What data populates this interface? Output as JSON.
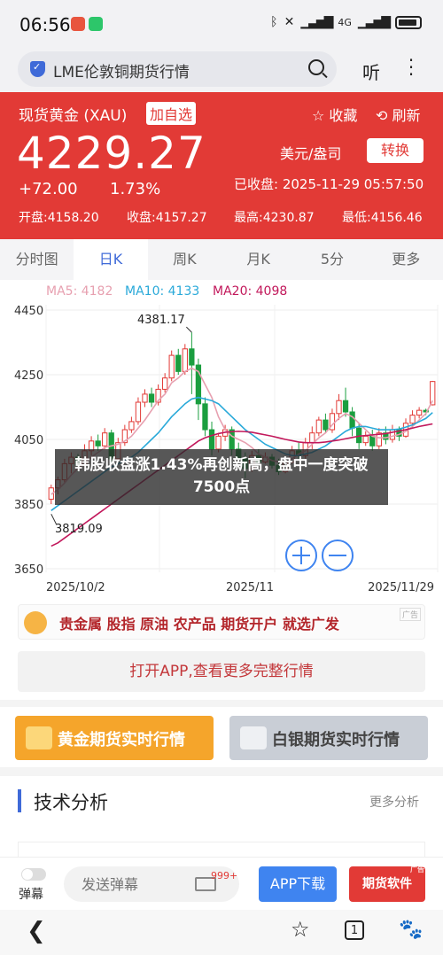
{
  "status_bar": {
    "time": "06:56",
    "network": "4G",
    "icons": [
      "weibo-icon",
      "wechat-icon",
      "bluetooth-icon",
      "mute-icon",
      "signal-icon",
      "battery-icon"
    ]
  },
  "browser": {
    "search_text": "LME伦敦铜期货行情",
    "listen_label": "听"
  },
  "quote": {
    "name": "现货黄金 (XAU)",
    "add_label": "加自选",
    "fav_label": "☆ 收藏",
    "refresh_label": "⟲ 刷新",
    "price": "4229.27",
    "unit": "美元/盎司",
    "switch_label": "转换",
    "change": "+72.00",
    "change_pct": "1.73%",
    "close_time": "已收盘: 2025-11-29 05:57:50",
    "open": "开盘:4158.20",
    "prev_close": "收盘:4157.27",
    "high": "最高:4230.87",
    "low": "最低:4156.46"
  },
  "tabs": [
    {
      "label": "分时图"
    },
    {
      "label": "日K"
    },
    {
      "label": "周K"
    },
    {
      "label": "月K"
    },
    {
      "label": "5分"
    },
    {
      "label": "更多"
    }
  ],
  "chart": {
    "ma5": "MA5: 4182",
    "ma10": "MA10: 4133",
    "ma20": "MA20: 4098",
    "y_ticks": [
      "4450",
      "4250",
      "4050",
      "3850",
      "3650"
    ],
    "x_ticks": [
      "2025/10/2",
      "2025/11",
      "2025/11/29"
    ],
    "max_label": "4381.17",
    "min_label": "3819.09",
    "overlay_text": "韩股收盘涨1.43%再创新高，盘中一度突破7500点",
    "colors": {
      "up": "#e23a36",
      "down": "#1a9e3f",
      "ma5": "#e7a0b0",
      "ma10": "#29a9d9",
      "ma20": "#c2185b"
    }
  },
  "chart_data": {
    "type": "candlestick",
    "y_range": [
      3650,
      4450
    ],
    "x_labels": [
      "2025/10/2",
      "2025/11",
      "2025/11/29"
    ],
    "max_annotation": 4381.17,
    "min_annotation": 3819.09,
    "candles": [
      [
        3865,
        3900,
        3850,
        3910
      ],
      [
        3900,
        3925,
        3880,
        3935
      ],
      [
        3925,
        3975,
        3915,
        3990
      ],
      [
        3975,
        3995,
        3945,
        4010
      ],
      [
        3995,
        3970,
        3950,
        4005
      ],
      [
        3970,
        4015,
        3960,
        4035
      ],
      [
        4015,
        4045,
        4000,
        4060
      ],
      [
        4045,
        4030,
        4015,
        4065
      ],
      [
        4030,
        4070,
        4020,
        4085
      ],
      [
        4070,
        3990,
        3975,
        4080
      ],
      [
        3990,
        4040,
        3985,
        4055
      ],
      [
        4040,
        4080,
        4030,
        4095
      ],
      [
        4080,
        4105,
        4070,
        4120
      ],
      [
        4105,
        4165,
        4095,
        4180
      ],
      [
        4165,
        4190,
        4150,
        4205
      ],
      [
        4190,
        4165,
        4150,
        4210
      ],
      [
        4165,
        4205,
        4155,
        4220
      ],
      [
        4205,
        4240,
        4195,
        4255
      ],
      [
        4240,
        4310,
        4230,
        4325
      ],
      [
        4310,
        4260,
        4250,
        4330
      ],
      [
        4260,
        4330,
        4250,
        4345
      ],
      [
        4330,
        4280,
        4190,
        4381.17
      ],
      [
        4280,
        4160,
        4110,
        4300
      ],
      [
        4160,
        4080,
        4060,
        4180
      ],
      [
        4080,
        4020,
        4000,
        4105
      ],
      [
        4020,
        4060,
        4010,
        4070
      ],
      [
        4060,
        4080,
        4045,
        4095
      ],
      [
        4080,
        4020,
        4000,
        4090
      ],
      [
        4020,
        3990,
        3980,
        4040
      ],
      [
        3990,
        3960,
        3930,
        4010
      ],
      [
        3960,
        4000,
        3950,
        4015
      ],
      [
        4000,
        3980,
        3970,
        4020
      ],
      [
        3980,
        3995,
        3975,
        4010
      ],
      [
        3995,
        3970,
        3960,
        4005
      ],
      [
        3970,
        3950,
        3940,
        3990
      ],
      [
        3950,
        3980,
        3945,
        3990
      ],
      [
        3980,
        4015,
        3975,
        4030
      ],
      [
        4015,
        4000,
        3990,
        4040
      ],
      [
        4000,
        4040,
        3990,
        4055
      ],
      [
        4040,
        4070,
        4020,
        4090
      ],
      [
        4070,
        4110,
        4060,
        4120
      ],
      [
        4110,
        4080,
        4070,
        4130
      ],
      [
        4080,
        4130,
        4070,
        4145
      ],
      [
        4130,
        4170,
        4110,
        4190
      ],
      [
        4170,
        4135,
        4120,
        4210
      ],
      [
        4135,
        4085,
        4060,
        4150
      ],
      [
        4085,
        4040,
        4020,
        4100
      ],
      [
        4040,
        4060,
        4030,
        4075
      ],
      [
        4060,
        4030,
        4015,
        4080
      ],
      [
        4030,
        4070,
        4020,
        4085
      ],
      [
        4070,
        4050,
        4035,
        4090
      ],
      [
        4050,
        4080,
        4040,
        4095
      ],
      [
        4080,
        4060,
        4045,
        4090
      ],
      [
        4060,
        4100,
        4055,
        4115
      ],
      [
        4100,
        4125,
        4085,
        4140
      ],
      [
        4125,
        4140,
        4115,
        4150
      ],
      [
        4140,
        4135,
        4125,
        4145
      ],
      [
        4157,
        4229,
        4155,
        4231
      ]
    ],
    "series": [
      {
        "name": "MA5",
        "values": [
          3880,
          3895,
          3915,
          3940,
          3960,
          3975,
          3995,
          4010,
          4025,
          4030,
          4035,
          4045,
          4060,
          4085,
          4110,
          4140,
          4170,
          4190,
          4225,
          4240,
          4260,
          4270,
          4260,
          4220,
          4180,
          4120,
          4080,
          4060,
          4050,
          4040,
          4025,
          4005,
          3995,
          3985,
          3980,
          3980,
          3990,
          4005,
          4015,
          4035,
          4055,
          4070,
          4095,
          4115,
          4130,
          4120,
          4100,
          4080,
          4060,
          4055,
          4055,
          4060,
          4065,
          4075,
          4090,
          4110,
          4130,
          4170
        ]
      },
      {
        "name": "MA10",
        "values": [
          3830,
          3845,
          3860,
          3875,
          3890,
          3905,
          3920,
          3935,
          3950,
          3965,
          3975,
          3985,
          3995,
          4010,
          4030,
          4050,
          4070,
          4095,
          4120,
          4140,
          4160,
          4175,
          4180,
          4175,
          4170,
          4160,
          4140,
          4120,
          4100,
          4080,
          4065,
          4050,
          4035,
          4025,
          4015,
          4005,
          4000,
          4000,
          4005,
          4010,
          4020,
          4030,
          4045,
          4060,
          4075,
          4085,
          4090,
          4090,
          4085,
          4080,
          4080,
          4080,
          4082,
          4088,
          4095,
          4105,
          4115,
          4133
        ]
      },
      {
        "name": "MA20",
        "values": [
          3720,
          3730,
          3745,
          3760,
          3775,
          3790,
          3805,
          3820,
          3835,
          3850,
          3865,
          3880,
          3895,
          3910,
          3925,
          3940,
          3955,
          3970,
          3985,
          4000,
          4015,
          4030,
          4045,
          4055,
          4062,
          4068,
          4072,
          4074,
          4075,
          4074,
          4072,
          4068,
          4064,
          4060,
          4055,
          4050,
          4046,
          4042,
          4040,
          4040,
          4040,
          4042,
          4045,
          4048,
          4052,
          4056,
          4060,
          4062,
          4064,
          4066,
          4068,
          4072,
          4076,
          4080,
          4085,
          4090,
          4094,
          4098
        ]
      }
    ]
  },
  "ad": {
    "text": "贵金属 股指 原油 农产品 期货开户 就选广发",
    "badge": "广告"
  },
  "open_app_label": "打开APP,查看更多完整行情",
  "buttons": {
    "gold": "黄金期货实时行情",
    "silver": "白银期货实时行情"
  },
  "tech": {
    "title": "技术分析",
    "more": "更多分析"
  },
  "bottom": {
    "danmu_label": "弹幕",
    "input_placeholder": "发送弹幕",
    "badge_count": "999+",
    "app_download": "APP下载",
    "futures_soft": "期货软件",
    "ad_tag": "广告"
  },
  "nav": {
    "pages_count": "1"
  }
}
